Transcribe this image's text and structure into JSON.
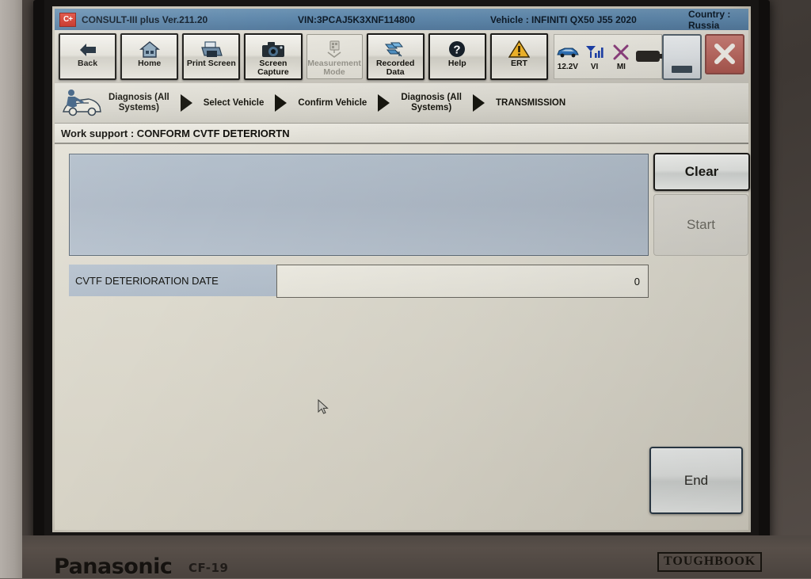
{
  "titlebar": {
    "logo_text": "C+",
    "app_name": "CONSULT-III plus  Ver.211.20",
    "vin": "VIN:3PCAJ5K3XNF114800",
    "vehicle": "Vehicle : INFINITI QX50 J55 2020",
    "country": "Country : Russia",
    "bg_color": "#5e87ab"
  },
  "toolbar": {
    "buttons": [
      {
        "label": "Back",
        "icon": "back-arrow-icon",
        "enabled": true
      },
      {
        "label": "Home",
        "icon": "house-icon",
        "enabled": true
      },
      {
        "label": "Print Screen",
        "icon": "printer-icon",
        "enabled": true
      },
      {
        "label": "Screen\nCapture",
        "icon": "camera-icon",
        "enabled": true
      },
      {
        "label": "Measurement\nMode",
        "icon": "measurement-icon",
        "enabled": false
      },
      {
        "label": "Recorded\nData",
        "icon": "recorded-data-icon",
        "enabled": true
      },
      {
        "label": "Help",
        "icon": "question-mark-icon",
        "enabled": true
      },
      {
        "label": "ERT",
        "icon": "warning-triangle-icon",
        "enabled": true
      }
    ],
    "labels": {
      "back": "Back",
      "home": "Home",
      "print_screen": "Print Screen",
      "screen_capture_l1": "Screen",
      "screen_capture_l2": "Capture",
      "measurement_l1": "Measurement",
      "measurement_l2": "Mode",
      "recorded_l1": "Recorded",
      "recorded_l2": "Data",
      "help": "Help",
      "ert": "ERT"
    },
    "status": {
      "voltage": "12.2V",
      "vi": "VI",
      "mi": "MI"
    },
    "window_controls": {
      "minimize": "minimize-button",
      "close": "close-button"
    }
  },
  "breadcrumb": {
    "items": [
      "Diagnosis (All Systems)",
      "Select Vehicle",
      "Confirm Vehicle",
      "Diagnosis (All Systems)",
      "TRANSMISSION"
    ],
    "item0_l1": "Diagnosis (All",
    "item0_l2": "Systems)",
    "item1": "Select Vehicle",
    "item2": "Confirm Vehicle",
    "item3_l1": "Diagnosis (All",
    "item3_l2": "Systems)",
    "item4": "TRANSMISSION"
  },
  "subheader": {
    "text": "Work support : CONFORM CVTF DETERIORTN"
  },
  "main": {
    "message_panel_text": "",
    "row": {
      "label": "CVTF DETERIORATION DATE",
      "value": "0"
    },
    "buttons": {
      "clear": "Clear",
      "start": "Start",
      "end": "End"
    }
  },
  "hardware": {
    "brand": "Panasonic",
    "model": "CF-19",
    "series": "TOUGHBOOK"
  }
}
